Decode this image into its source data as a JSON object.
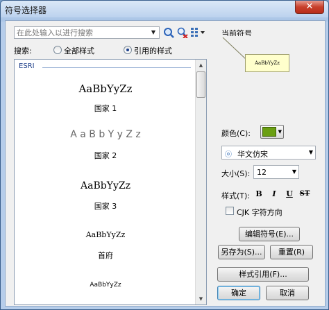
{
  "window": {
    "title": "符号选择器",
    "close_label": "✕"
  },
  "search": {
    "placeholder": "在此处输入以进行搜索"
  },
  "filter": {
    "label": "搜索:",
    "options": [
      {
        "label": "全部样式",
        "checked": false
      },
      {
        "label": "引用的样式",
        "checked": true
      }
    ]
  },
  "symbol_list": {
    "group": "ESRI",
    "items": [
      {
        "preview": "AaBbYyZz",
        "name": "国家 1"
      },
      {
        "preview": "A a B b Y y Z z",
        "name": "国家 2"
      },
      {
        "preview": "AaBbYyZz",
        "name": "国家 3"
      },
      {
        "preview": "AaBbYyZz",
        "name": "首府"
      },
      {
        "preview": "AaBbYyZz",
        "name": ""
      }
    ]
  },
  "current_symbol": {
    "label": "当前符号",
    "preview_text": "AaBbYyZz"
  },
  "properties": {
    "color_label": "颜色(C):",
    "color_value": "#6a9f12",
    "font_value": "华文仿宋",
    "size_label": "大小(S):",
    "size_value": "12",
    "style_label": "样式(T):",
    "style_buttons": [
      "B",
      "I",
      "U",
      "ST"
    ],
    "cjk_label": "CJK 字符方向",
    "cjk_checked": false
  },
  "buttons": {
    "edit_symbol": "编辑符号(E)...",
    "save_as": "另存为(S)...",
    "reset": "重置(R)",
    "style_refs": "样式引用(F)...",
    "ok": "确定",
    "cancel": "取消"
  },
  "icons": {
    "search": "search-icon",
    "clear_search": "clear-search-icon",
    "view_options": "grid-view-icon"
  }
}
